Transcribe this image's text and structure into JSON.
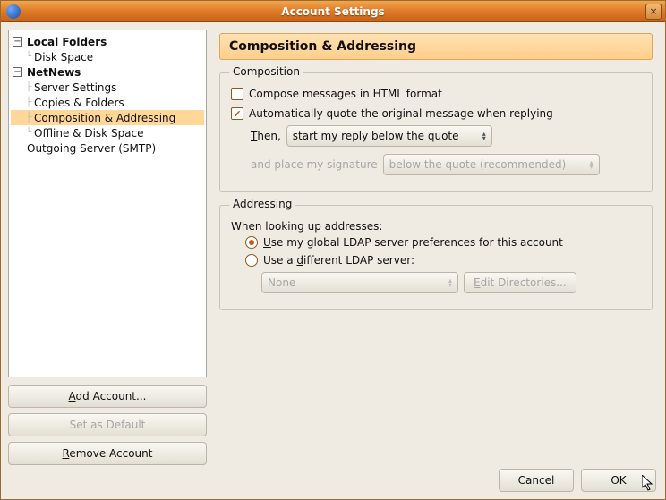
{
  "window": {
    "title": "Account Settings",
    "close_glyph": "×"
  },
  "tree": {
    "localfolders": {
      "label": "Local Folders",
      "diskspace": "Disk Space"
    },
    "netnews": {
      "label": "NetNews",
      "server": "Server Settings",
      "copies": "Copies & Folders",
      "comp": "Composition & Addressing",
      "offline": "Offline & Disk Space"
    },
    "outgoing": "Outgoing Server (SMTP)"
  },
  "side_buttons": {
    "add": "Add Account...",
    "setdefault": "Set as Default",
    "remove": "Remove Account"
  },
  "page": {
    "title": "Composition & Addressing"
  },
  "composition": {
    "legend": "Composition",
    "html_checked": false,
    "html_label": "Compose messages in HTML format",
    "quote_checked": true,
    "quote_label": "Automatically quote the original message when replying",
    "then_prefix": "Then,",
    "then_accel": "T",
    "reply_select": "start my reply below the quote",
    "sig_prefix": "and place my signature",
    "sig_select": "below the quote (recommended)",
    "sig_enabled": false
  },
  "addressing": {
    "legend": "Addressing",
    "lookup_label": "When looking up addresses:",
    "opt_global_prefix": "U",
    "opt_global_rest": "se my global LDAP server preferences for this account",
    "opt_diff_prefix": "Use a ",
    "opt_diff_accel": "d",
    "opt_diff_rest": "ifferent LDAP server:",
    "selected": "global",
    "server_select": "None",
    "edit_prefix": "E",
    "edit_rest": "dit Directories..."
  },
  "footer": {
    "cancel": "Cancel",
    "ok": "OK"
  }
}
